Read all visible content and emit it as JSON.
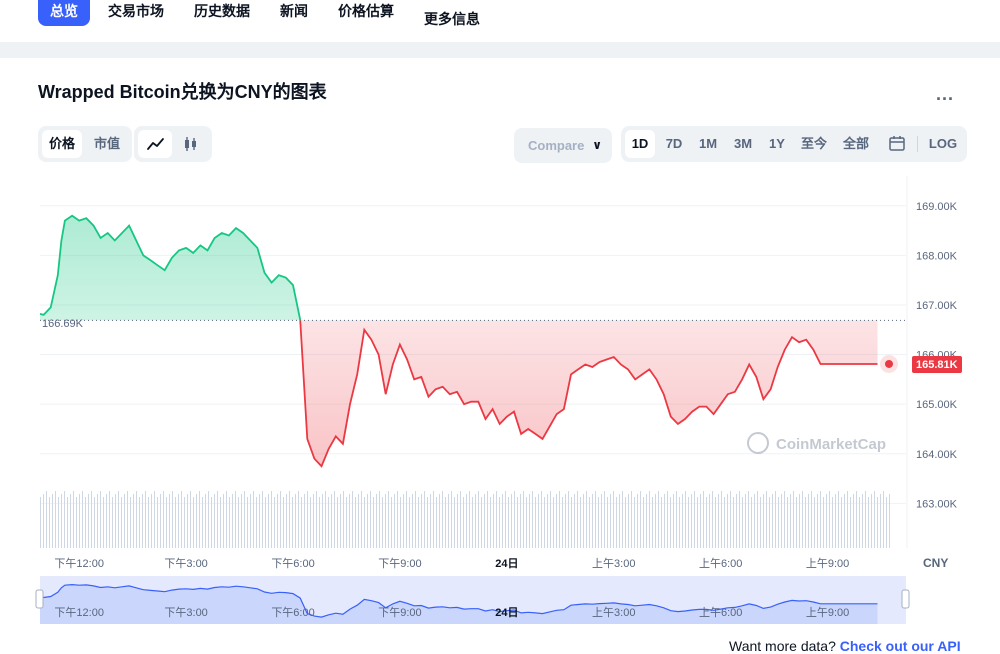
{
  "nav": {
    "items": [
      "总览",
      "交易市场",
      "历史数据",
      "新闻",
      "价格估算",
      "更多信息"
    ]
  },
  "header": {
    "title": "Wrapped Bitcoin兑换为CNY的图表",
    "more": "..."
  },
  "toolbar": {
    "metric_tabs": [
      "价格",
      "市值"
    ],
    "chart_type_icons": [
      "line-chart-icon",
      "candlestick-icon"
    ],
    "compare_label": "Compare",
    "ranges": [
      "1D",
      "7D",
      "1M",
      "3M",
      "1Y",
      "至今",
      "全部"
    ],
    "log_label": "LOG"
  },
  "watermark": "CoinMarketCap",
  "currency": "CNY",
  "footer": {
    "prefix": "Want more data?",
    "link": "Check out our API"
  },
  "colors": {
    "up": "#16c784",
    "down": "#ea3943",
    "accent": "#3861fb"
  },
  "chart_data": {
    "type": "line",
    "title": "",
    "open_price_label": "166.69K",
    "open_price": 166.69,
    "current_price_label": "165.81K",
    "current_price": 165.81,
    "y_ticks": [
      "169.00K",
      "168.00K",
      "167.00K",
      "166.00K",
      "165.00K",
      "164.00K",
      "163.00K"
    ],
    "y_tick_values": [
      169,
      168,
      167,
      166,
      165,
      164,
      163
    ],
    "ylim": [
      162.1,
      169.6
    ],
    "x_ticks": [
      "下午12:00",
      "下午3:00",
      "下午6:00",
      "下午9:00",
      "24日",
      "上午3:00",
      "上午6:00",
      "上午9:00"
    ],
    "x_tick_hours": [
      12,
      15,
      18,
      21,
      24,
      27,
      30,
      33
    ],
    "xlim": [
      10.9,
      35.2
    ],
    "series": [
      {
        "hours": [
          10.9,
          11.0,
          11.2,
          11.4,
          11.5,
          11.6,
          11.8,
          12.0,
          12.2,
          12.4,
          12.6,
          12.8,
          13.0,
          13.2,
          13.4,
          13.6,
          13.8,
          14.0,
          14.2,
          14.4,
          14.6,
          14.8,
          15.0,
          15.2,
          15.4,
          15.6,
          15.8,
          16.0,
          16.2,
          16.4,
          16.6,
          16.8,
          17.0,
          17.2,
          17.4,
          17.6,
          17.8,
          18.0,
          18.2,
          18.4,
          18.6,
          18.8,
          19.0,
          19.2,
          19.4,
          19.6,
          19.8,
          20.0,
          20.2,
          20.4,
          20.6,
          20.8,
          21.0,
          21.2,
          21.4,
          21.6,
          21.8,
          22.0,
          22.2,
          22.4,
          22.6,
          22.8,
          23.0,
          23.2,
          23.4,
          23.6,
          23.8,
          24.0,
          24.2,
          24.4,
          24.6,
          24.8,
          25.0,
          25.2,
          25.4,
          25.6,
          25.8,
          26.0,
          26.2,
          26.4,
          26.6,
          26.8,
          27.0,
          27.2,
          27.4,
          27.6,
          27.8,
          28.0,
          28.2,
          28.4,
          28.6,
          28.8,
          29.0,
          29.2,
          29.4,
          29.6,
          29.8,
          30.0,
          30.2,
          30.4,
          30.6,
          30.8,
          31.0,
          31.2,
          31.4,
          31.6,
          31.8,
          32.0,
          32.2,
          32.4,
          32.6,
          32.8,
          33.0,
          33.2,
          33.4,
          33.6,
          33.8,
          34.0,
          34.2,
          34.4
        ],
        "values": [
          166.82,
          166.8,
          166.95,
          167.6,
          168.3,
          168.7,
          168.8,
          168.7,
          168.75,
          168.6,
          168.35,
          168.45,
          168.3,
          168.45,
          168.6,
          168.3,
          168.0,
          167.9,
          167.8,
          167.7,
          167.95,
          168.1,
          168.15,
          168.05,
          168.2,
          168.1,
          168.35,
          168.45,
          168.4,
          168.55,
          168.45,
          168.3,
          168.15,
          167.65,
          167.45,
          167.6,
          167.55,
          167.4,
          166.7,
          164.3,
          163.9,
          163.75,
          164.1,
          164.35,
          164.2,
          165.0,
          165.6,
          166.5,
          166.3,
          166.0,
          165.2,
          165.8,
          166.2,
          165.9,
          165.5,
          165.55,
          165.15,
          165.3,
          165.35,
          165.2,
          165.25,
          165.0,
          165.05,
          165.05,
          164.7,
          164.9,
          164.6,
          164.75,
          164.85,
          164.4,
          164.5,
          164.4,
          164.3,
          164.55,
          164.8,
          164.9,
          165.6,
          165.7,
          165.8,
          165.75,
          165.85,
          165.9,
          165.95,
          165.8,
          165.7,
          165.5,
          165.6,
          165.7,
          165.5,
          165.2,
          164.75,
          164.6,
          164.7,
          164.85,
          164.95,
          164.95,
          164.8,
          165.0,
          165.2,
          165.25,
          165.5,
          165.8,
          165.55,
          165.1,
          165.3,
          165.75,
          166.1,
          166.35,
          166.25,
          166.3,
          166.1,
          165.81,
          165.81,
          165.81,
          165.81,
          165.81,
          165.81,
          165.81,
          165.81,
          165.81,
          165.81,
          165.81
        ]
      }
    ]
  }
}
